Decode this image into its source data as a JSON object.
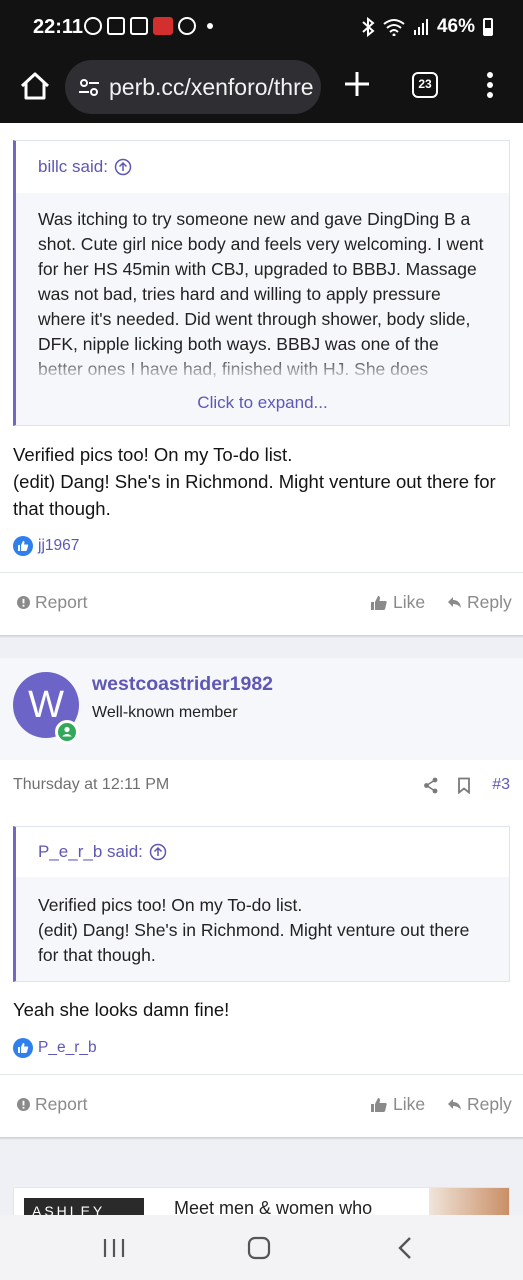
{
  "status_bar": {
    "time": "22:11",
    "battery": "46%",
    "icons": [
      "facebook-icon",
      "mail-icon",
      "tiktok-icon",
      "red-app-icon",
      "messenger-icon",
      "bluetooth-icon",
      "wifi-icon",
      "signal-icon",
      "battery-icon"
    ]
  },
  "browser": {
    "url": "perb.cc/xenforo/thre",
    "tab_count": "23"
  },
  "post1": {
    "quote_author": "billc said:",
    "quote_text": "Was itching to try someone new and gave DingDing B a shot. Cute girl nice body and feels very welcoming. I went for her HS 45min with CBJ, upgraded to BBBJ. Massage was not bad, tries hard and willing to apply pressure where it's needed. Did went through shower, body slide, DFK, nipple licking both ways. BBBJ was one of the better ones I have had, finished with HJ. She does",
    "expand_label": "Click to expand...",
    "message": "Verified pics too! On my To-do list.\n(edit) Dang! She's in Richmond. Might venture out there for that though.",
    "reaction_user": "jj1967",
    "report_label": "Report",
    "like_label": "Like",
    "reply_label": "Reply"
  },
  "post2": {
    "avatar_letter": "W",
    "username": "westcoastrider1982",
    "user_title": "Well-known member",
    "timestamp": "Thursday at 12:11 PM",
    "post_number": "#3",
    "quote_author": "P_e_r_b said:",
    "quote_text": "Verified pics too! On my To-do list.\n(edit) Dang! She's in Richmond. Might venture out there for that though.",
    "message": "Yeah she looks damn fine!",
    "reaction_user": "P_e_r_b",
    "report_label": "Report",
    "like_label": "Like",
    "reply_label": "Reply"
  },
  "ad": {
    "logo_text": "ASHLEY",
    "headline": "Meet men & women who"
  },
  "colors": {
    "accent": "#5f57b5",
    "quote_border": "#7167c5",
    "avatar_bg": "#6d64c7",
    "online": "#31a95b",
    "like_blue": "#2f80ed"
  }
}
